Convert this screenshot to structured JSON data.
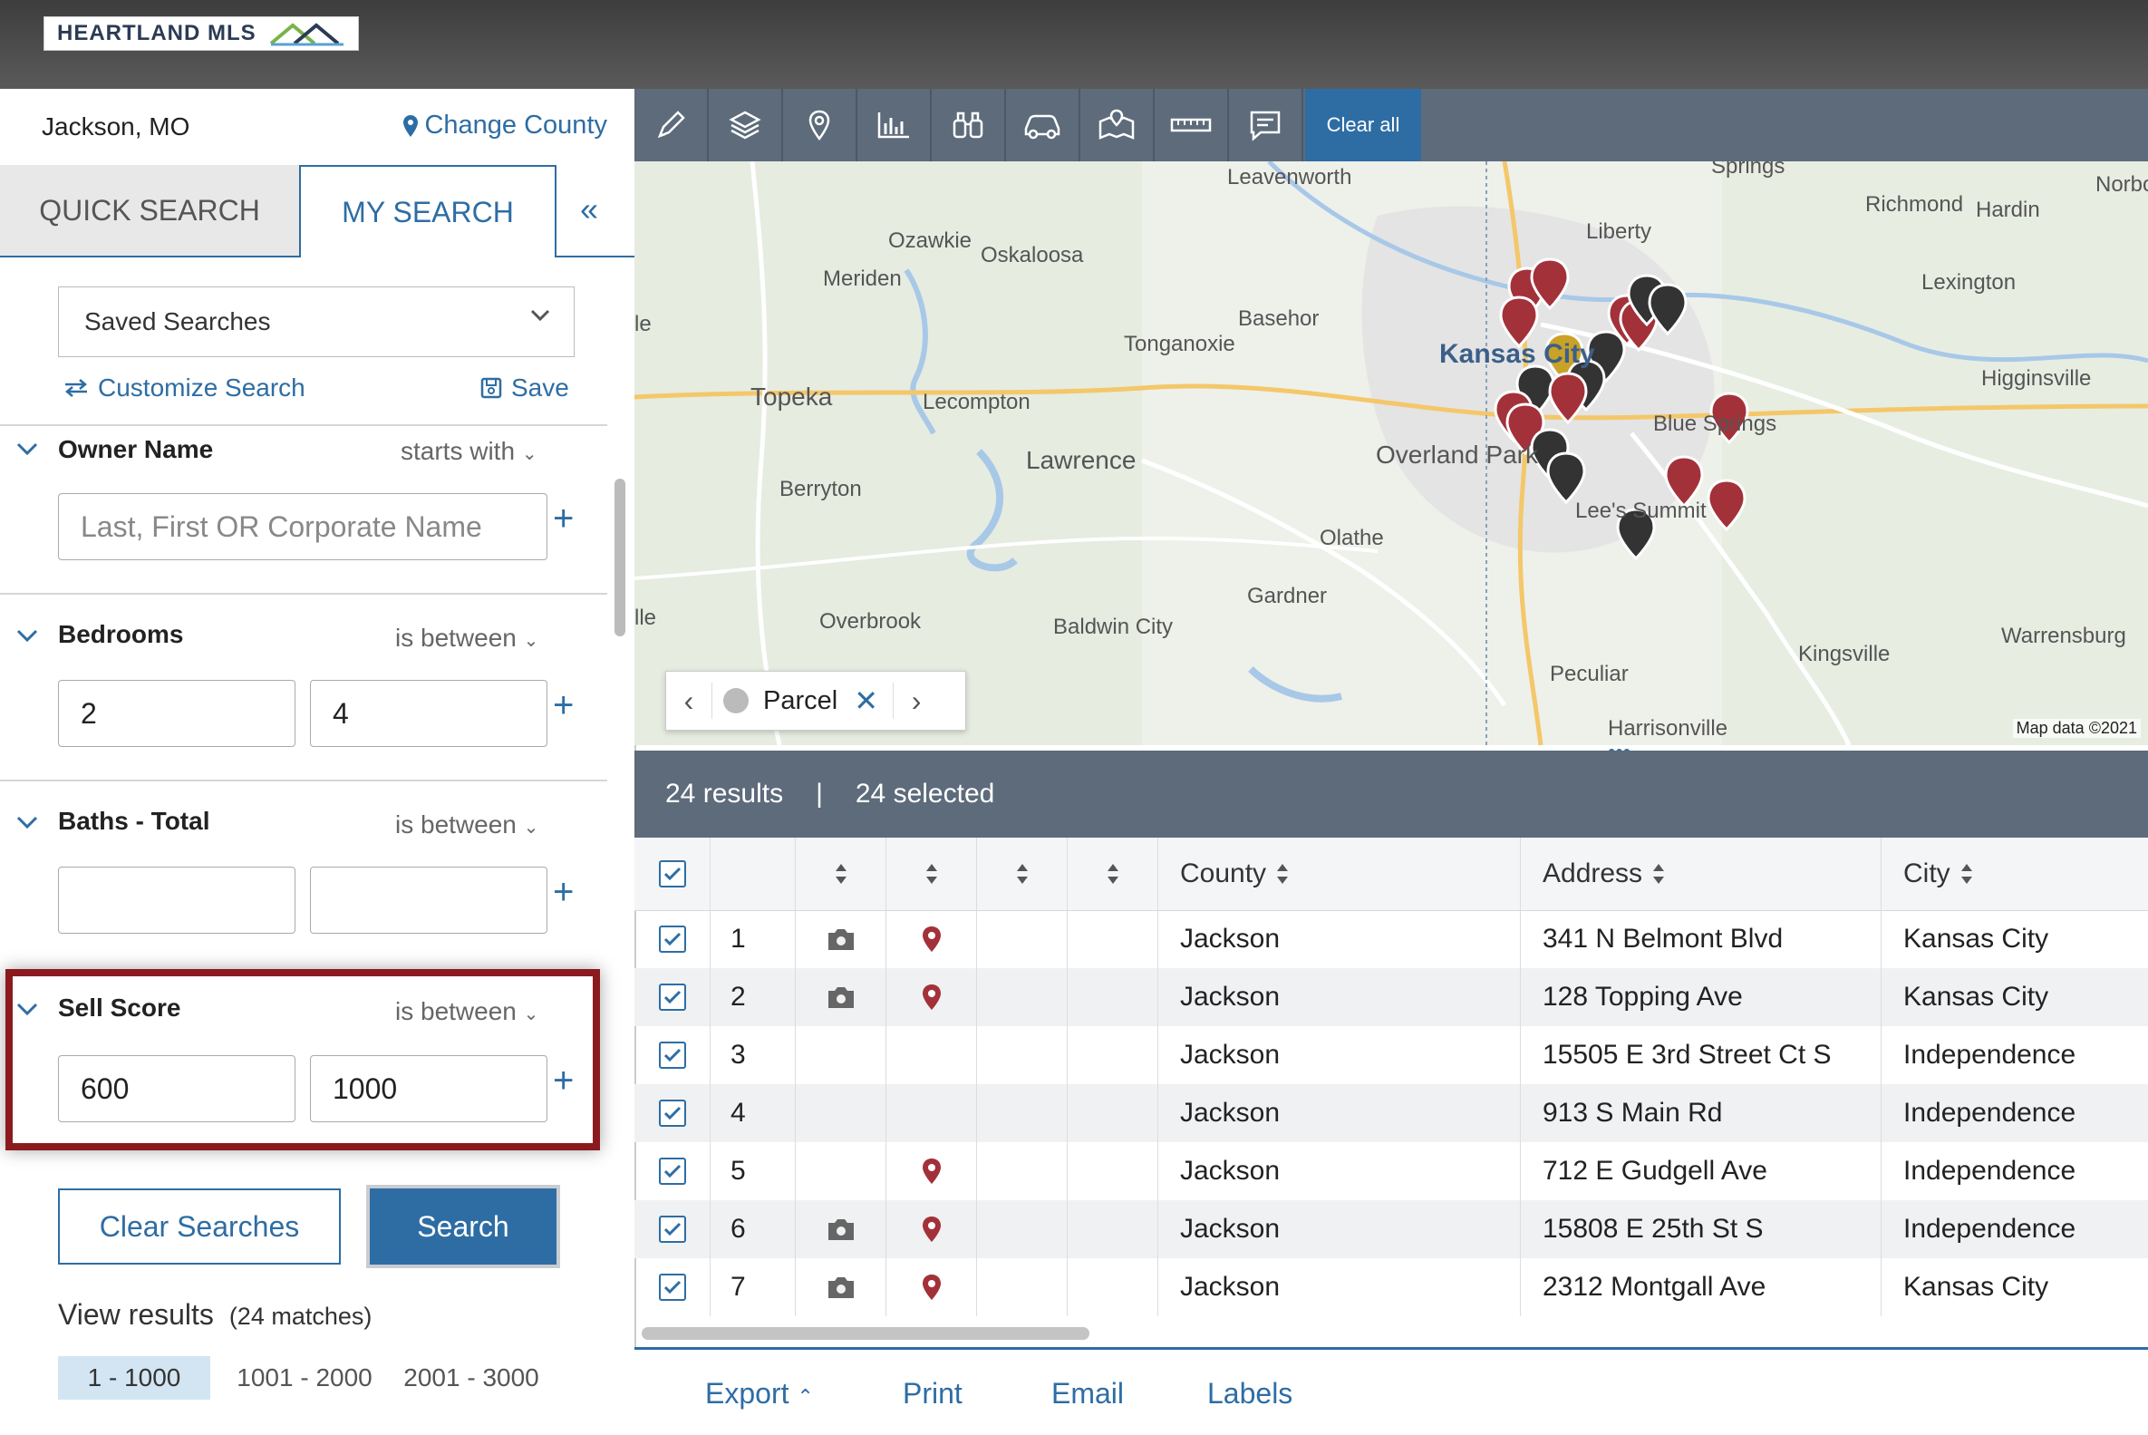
{
  "brand": {
    "name": "HEARTLAND MLS"
  },
  "county": {
    "name": "Jackson, MO",
    "change_label": "Change County"
  },
  "tabs": {
    "quick": "QUICK SEARCH",
    "my": "MY SEARCH",
    "collapse": "«"
  },
  "saved_searches": {
    "label": "Saved Searches"
  },
  "actions": {
    "customize": "Customize Search",
    "save": "Save"
  },
  "criteria": {
    "owner": {
      "label": "Owner Name",
      "op": "starts with",
      "placeholder": "Last, First OR Corporate Name"
    },
    "bedrooms": {
      "label": "Bedrooms",
      "op": "is between",
      "min": "2",
      "max": "4"
    },
    "baths": {
      "label": "Baths - Total",
      "op": "is between",
      "min": "",
      "max": ""
    },
    "sell_score": {
      "label": "Sell Score",
      "op": "is between",
      "min": "600",
      "max": "1000"
    }
  },
  "buttons": {
    "clear": "Clear Searches",
    "search": "Search"
  },
  "view_results": {
    "label": "View results",
    "matches": "(24 matches)",
    "pages": [
      "1 - 1000",
      "1001 - 2000",
      "2001 - 3000"
    ]
  },
  "toolbar": {
    "icons": [
      "pencil-icon",
      "layers-icon",
      "map-pin-icon",
      "bar-chart-icon",
      "binoculars-icon",
      "car-icon",
      "map-area-icon",
      "ruler-icon",
      "comment-icon"
    ],
    "clear_all": "Clear all"
  },
  "map": {
    "labels": {
      "leavenworth": "Leavenworth",
      "springs": "Springs",
      "norborne": "Norborn",
      "richmond": "Richmond",
      "hardin": "Hardin",
      "liberty": "Liberty",
      "ozawkie": "Ozawkie",
      "oskaloosa": "Oskaloosa",
      "meriden": "Meriden",
      "lexington": "Lexington",
      "basehor": "Basehor",
      "kansas_city": "Kansas City",
      "tonganoxie": "Tonganoxie",
      "higginsville": "Higginsville",
      "topeka": "Topeka",
      "lecompton": "Lecompton",
      "blue_springs": "Blue Springs",
      "overland_park": "Overland Park",
      "lawrence": "Lawrence",
      "berryton": "Berryton",
      "lees_summit": "Lee's Summit",
      "olathe": "Olathe",
      "gardner": "Gardner",
      "overbrook": "Overbrook",
      "baldwin_city": "Baldwin City",
      "kingsville": "Kingsville",
      "warrensburg": "Warrensburg",
      "peculiar": "Peculiar",
      "harrisonville": "Harrisonville",
      "le": "le",
      "lle": "lle"
    },
    "parcel": "Parcel",
    "attribution": "Map data ©2021"
  },
  "results": {
    "count": "24 results",
    "selected": "24 selected"
  },
  "table": {
    "headers": [
      "County",
      "Address",
      "City"
    ],
    "rows": [
      {
        "n": "1",
        "photo": true,
        "pin": true,
        "county": "Jackson",
        "address": "341 N Belmont Blvd",
        "city": "Kansas City"
      },
      {
        "n": "2",
        "photo": true,
        "pin": true,
        "county": "Jackson",
        "address": "128 Topping Ave",
        "city": "Kansas City"
      },
      {
        "n": "3",
        "photo": false,
        "pin": false,
        "county": "Jackson",
        "address": "15505 E 3rd Street Ct S",
        "city": "Independence"
      },
      {
        "n": "4",
        "photo": false,
        "pin": false,
        "county": "Jackson",
        "address": "913 S Main Rd",
        "city": "Independence"
      },
      {
        "n": "5",
        "photo": false,
        "pin": true,
        "county": "Jackson",
        "address": "712 E Gudgell Ave",
        "city": "Independence"
      },
      {
        "n": "6",
        "photo": true,
        "pin": true,
        "county": "Jackson",
        "address": "15808 E 25th St S",
        "city": "Independence"
      },
      {
        "n": "7",
        "photo": true,
        "pin": true,
        "county": "Jackson",
        "address": "2312 Montgall Ave",
        "city": "Kansas City"
      }
    ]
  },
  "footer": {
    "export": "Export",
    "print": "Print",
    "email": "Email",
    "labels": "Labels"
  },
  "colors": {
    "accent": "#2e6da4",
    "highlight": "#8b1a1f",
    "toolbar": "#5d6b7b",
    "pin_red": "#a3313a",
    "pin_dark": "#333333",
    "pin_gold": "#c9a227"
  }
}
